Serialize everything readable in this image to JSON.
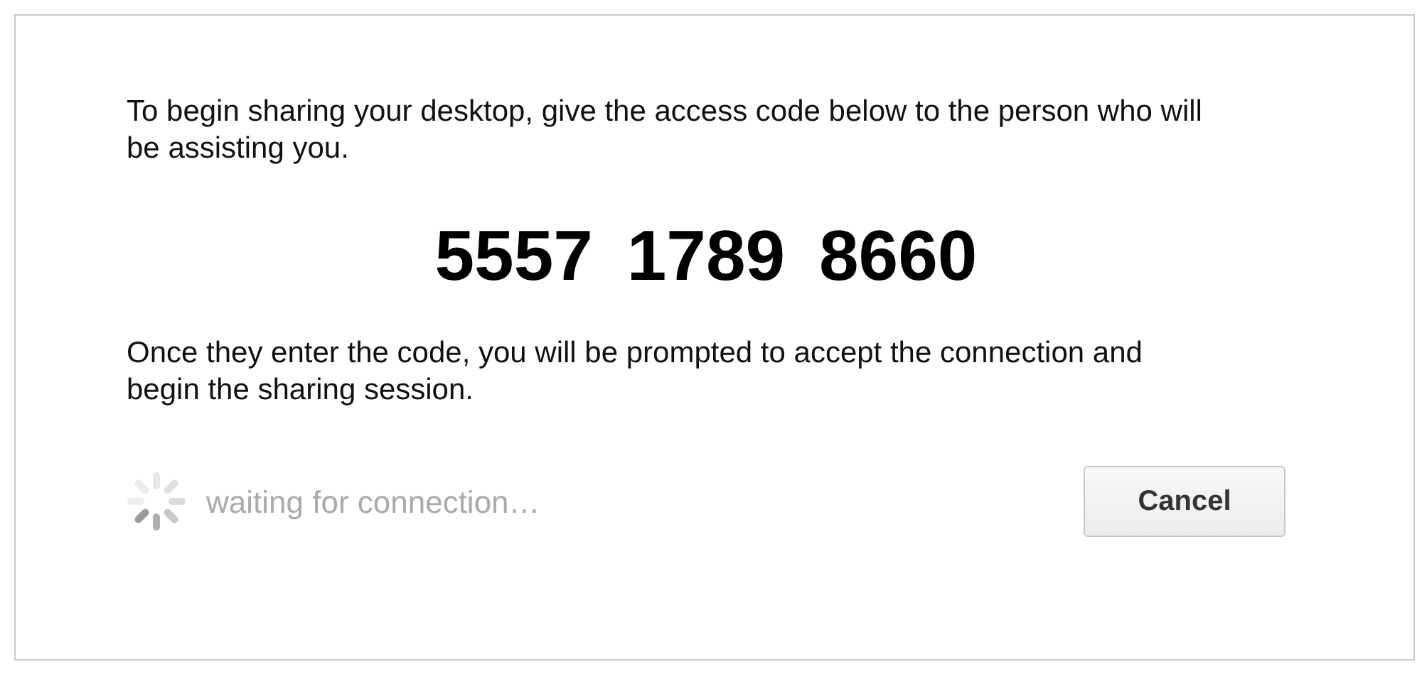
{
  "dialog": {
    "intro": "To begin sharing your desktop, give the access code below to the person who will be assisting you.",
    "access_code": "5557 1789 8660",
    "instructions": "Once they enter the code, you will be prompted to accept the connection and begin the sharing session.",
    "status": "waiting for connection…",
    "buttons": [
      {
        "label": "Cancel"
      }
    ]
  }
}
